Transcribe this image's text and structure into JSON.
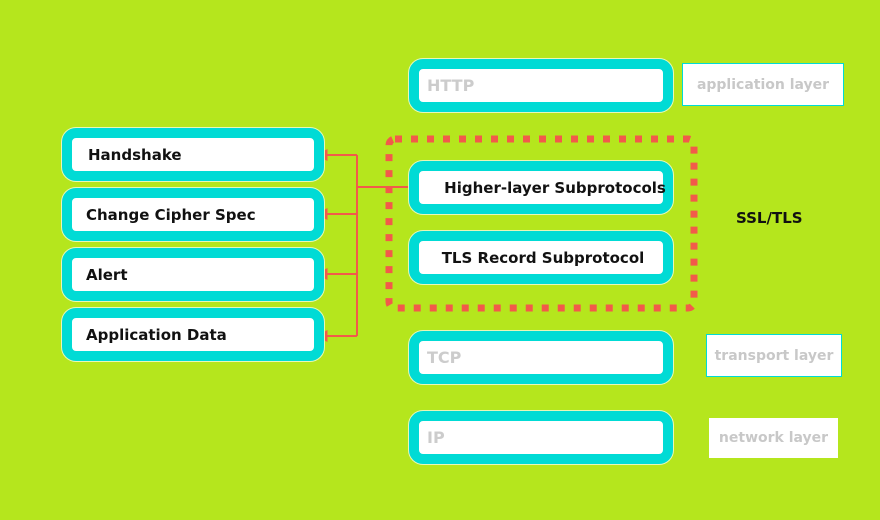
{
  "colors": {
    "background": "#b5e61d",
    "box_border": "#00dbd5",
    "connector": "#f25a4a",
    "dim_text": "#cccccc"
  },
  "stack": {
    "http": "HTTP",
    "higher_layer": "Higher-layer Subprotocols",
    "record": "TLS Record Subprotocol",
    "tcp": "TCP",
    "ip": "IP"
  },
  "layer_tags": {
    "application": "application layer",
    "transport": "transport layer",
    "network": "network layer"
  },
  "group_label": "SSL/TLS",
  "subprotocols": [
    {
      "label": "Handshake"
    },
    {
      "label": "Change Cipher Spec"
    },
    {
      "label": "Alert"
    },
    {
      "label": "Application Data"
    }
  ]
}
